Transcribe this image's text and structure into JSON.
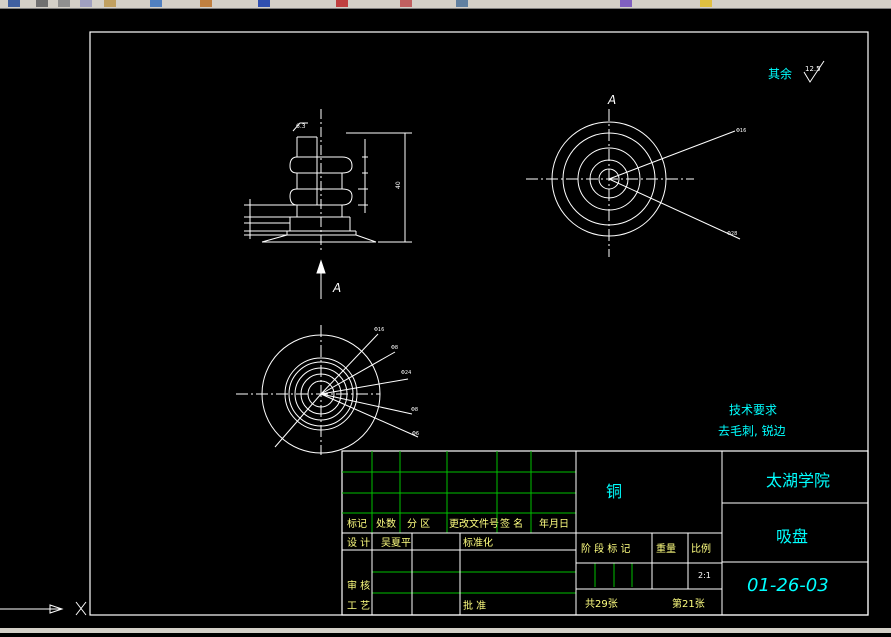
{
  "toolbar": {
    "icons": [
      "save-icon",
      "print-icon",
      "cut-icon",
      "copy-icon",
      "paste-icon",
      "undo-icon",
      "redo-icon",
      "pan-icon",
      "zoom-icon",
      "zoom-window-icon",
      "properties-icon",
      "layer-icon",
      "color-icon"
    ]
  },
  "drawing": {
    "roughness_label": "其余",
    "roughness_value": "12.5",
    "section_label_top": "A",
    "section_label_arrow": "A",
    "tech_req_title": "技术要求",
    "tech_req_text": "去毛刺, 锐边"
  },
  "title_block": {
    "material": "铜",
    "school": "太湖学院",
    "part_name": "吸盘",
    "drawing_number": "01-26-03",
    "scale": "2:1",
    "headers": [
      "标记",
      "处数",
      "分 区",
      "更改文件号",
      "签 名",
      "年月日"
    ],
    "design_label": "设 计",
    "designer": "吴夏平",
    "standardize_label": "标准化",
    "stage_label": "阶 段 标 记",
    "weight_label": "重量",
    "scale_label": "比例",
    "review_label": "审 核",
    "process_label": "工 艺",
    "approve_label": "批 准",
    "total_sheets": "共29张",
    "sheet_no": "第21张"
  },
  "colors": {
    "background": "#000000",
    "lines": "#ffffff",
    "grid": "#00c000",
    "annotation": "#00ffff",
    "toolbar": "#d4d0c8"
  }
}
